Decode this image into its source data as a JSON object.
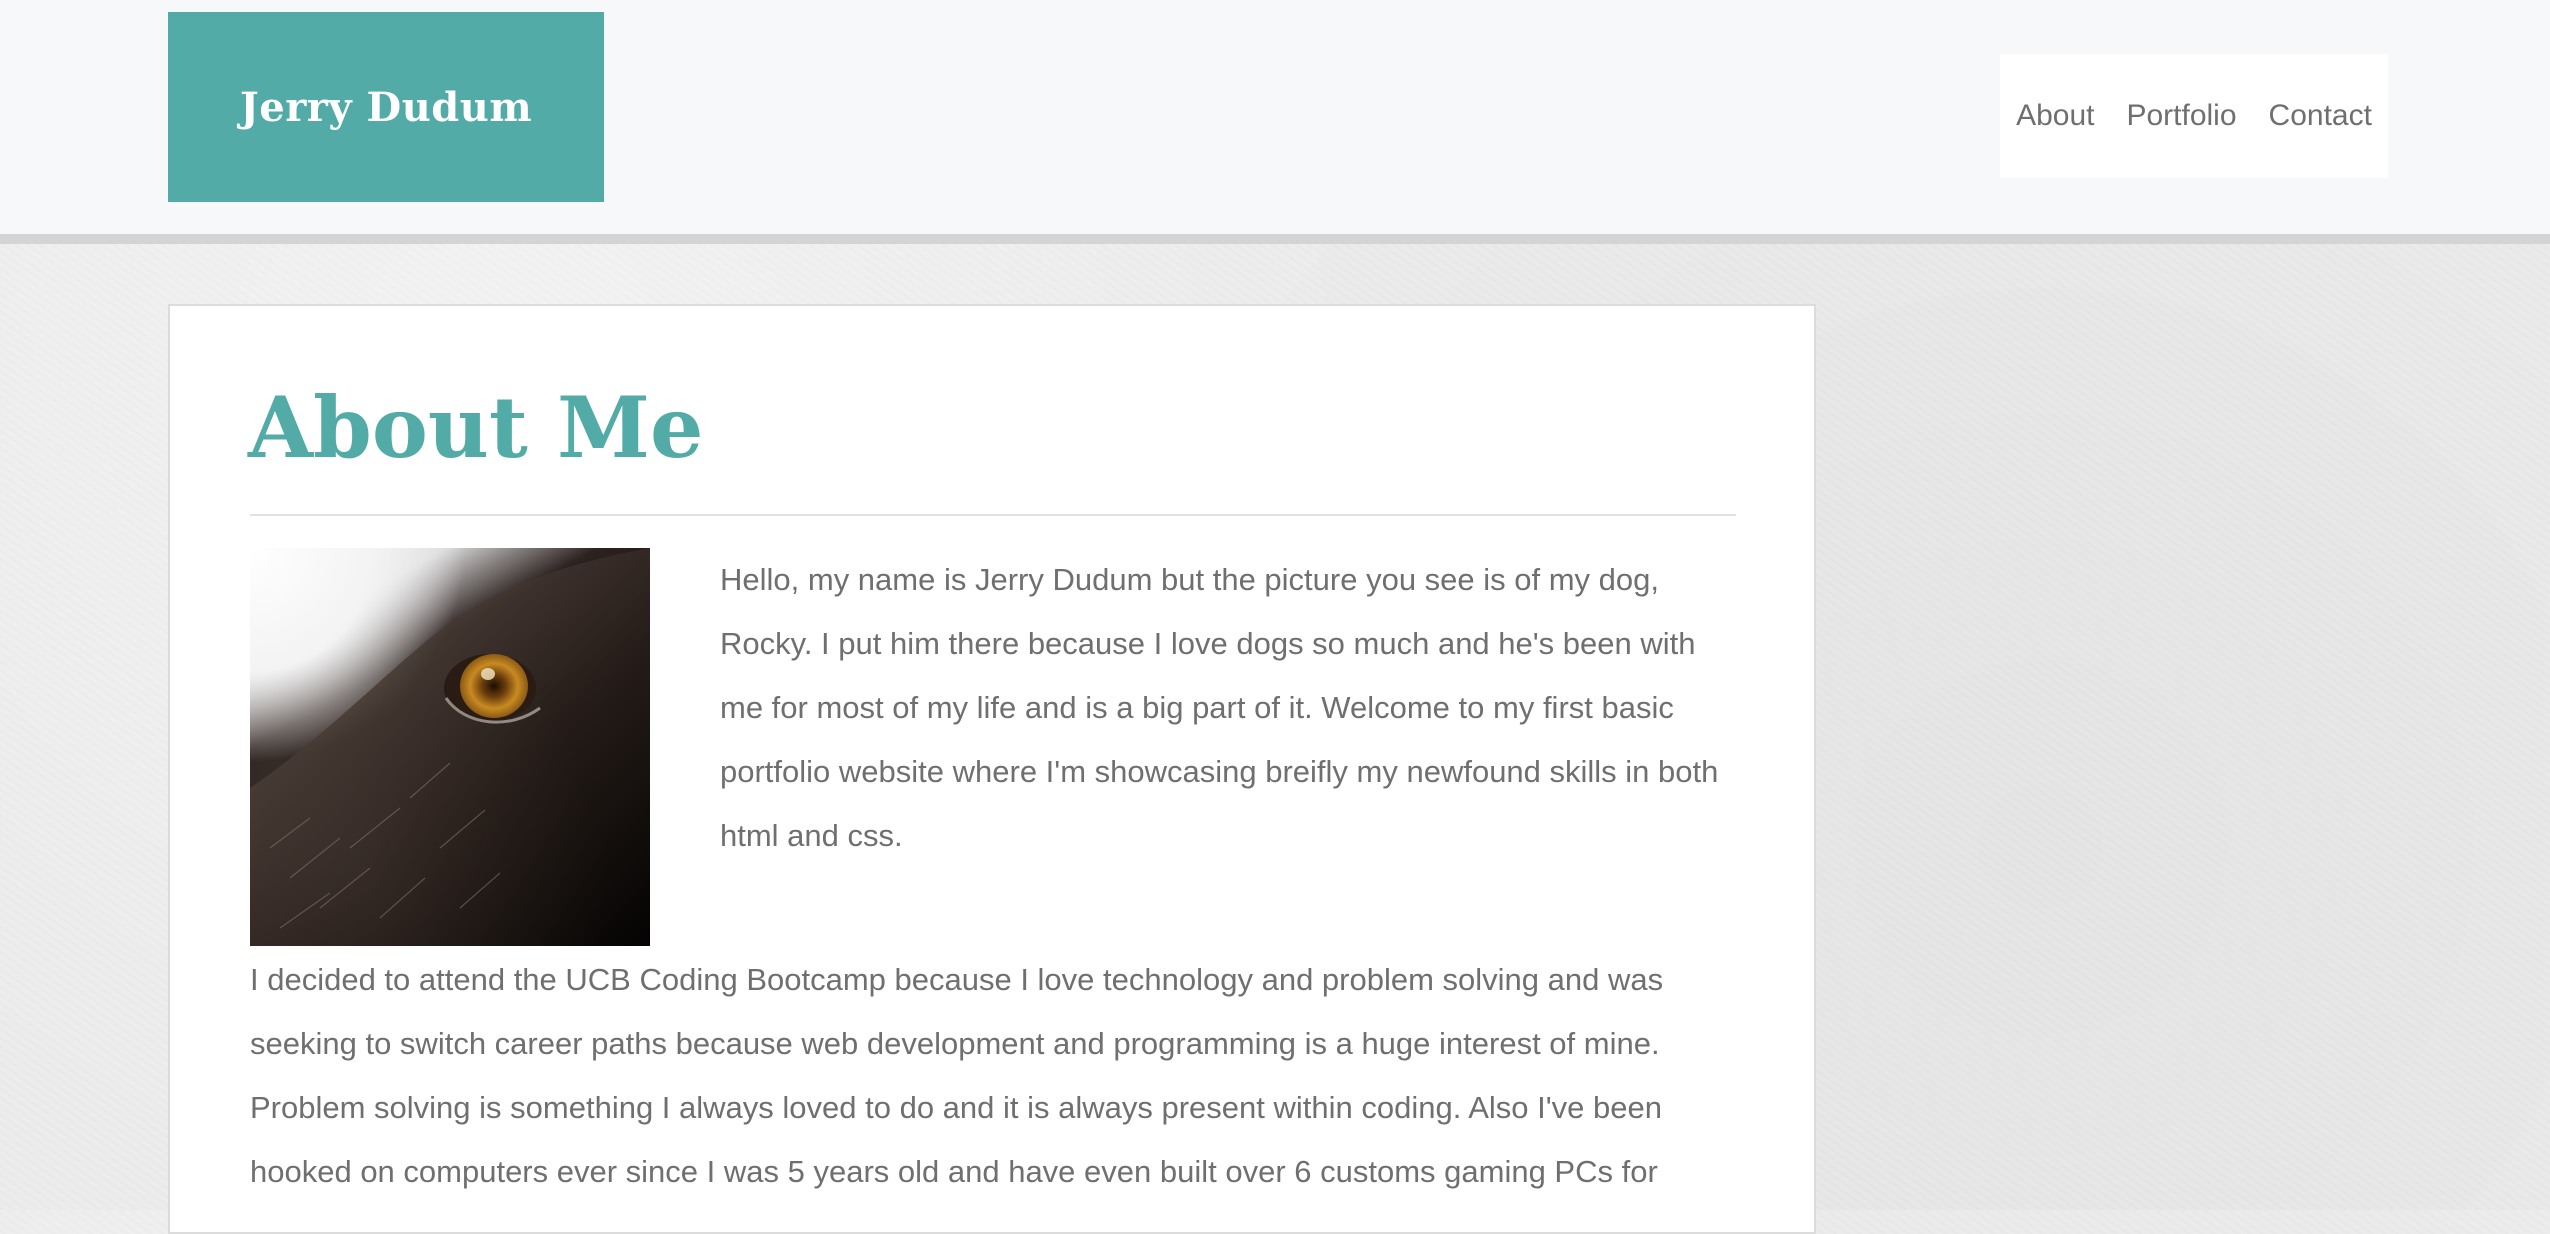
{
  "header": {
    "logo_text": "Jerry Dudum",
    "nav": [
      {
        "label": "About"
      },
      {
        "label": "Portfolio"
      },
      {
        "label": "Contact"
      }
    ]
  },
  "about": {
    "title": "About Me",
    "photo_alt": "Close-up of a dog's eye",
    "paragraph1": "Hello, my name is Jerry Dudum but the picture you see is of my dog, Rocky. I put him there because I love dogs so much and he's been with me for most of my life and is a big part of it. Welcome to my first basic portfolio website where I'm showcasing breifly my newfound skills in both html and css.",
    "paragraph2": "I decided to attend the UCB Coding Bootcamp because I love technology and problem solving and was seeking to switch career paths because web development and programming is a huge interest of mine. Problem solving is something I always loved to do and it is always present within coding. Also I've been hooked on computers ever since I was 5 years old and have even built over 6 customs gaming PCs for"
  },
  "colors": {
    "accent": "#52aba6",
    "text": "#6f6f6f",
    "header_bg": "#f7f8f9"
  }
}
